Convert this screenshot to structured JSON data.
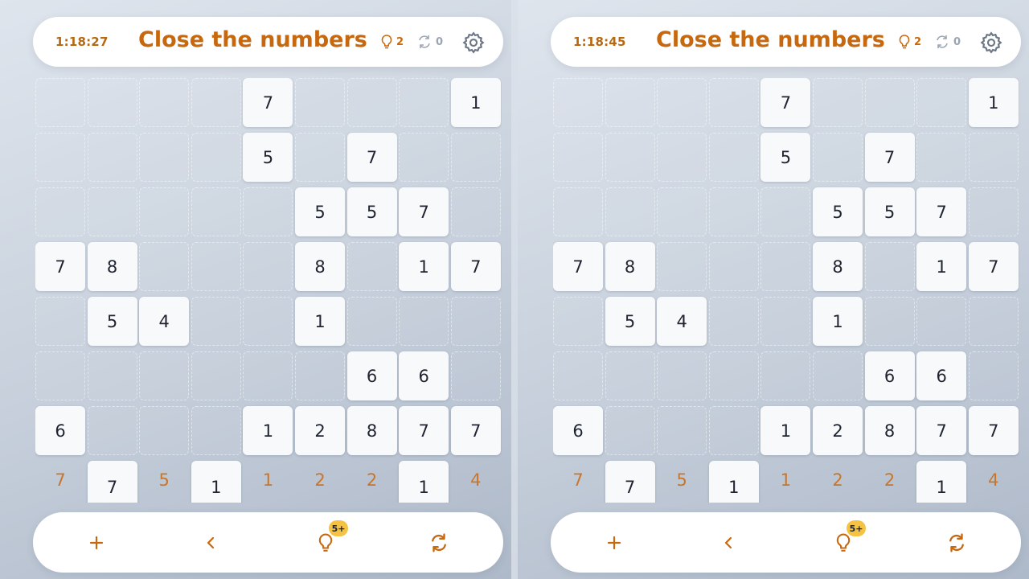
{
  "panels": [
    {
      "timer": "1:18:27",
      "title": "Close the numbers",
      "hint_count": "2",
      "shuffle_count": "0",
      "hint_badge": "5+"
    },
    {
      "timer": "1:18:45",
      "title": "Close the numbers",
      "hint_count": "2",
      "shuffle_count": "0",
      "hint_badge": "5+"
    }
  ],
  "board": {
    "rows": [
      [
        "",
        "",
        "",
        "",
        "7",
        "",
        "",
        "",
        "1"
      ],
      [
        "",
        "",
        "",
        "",
        "5",
        "",
        "7",
        "",
        ""
      ],
      [
        "",
        "",
        "",
        "",
        "",
        "5",
        "5",
        "7",
        ""
      ],
      [
        "7",
        "8",
        "",
        "",
        "",
        "8",
        "",
        "1",
        "7"
      ],
      [
        "",
        "5",
        "4",
        "",
        "",
        "1",
        "",
        "",
        ""
      ],
      [
        "",
        "",
        "",
        "",
        "",
        "",
        "6",
        "6",
        ""
      ],
      [
        "6",
        "",
        "",
        "",
        "1",
        "2",
        "8",
        "7",
        "7"
      ]
    ],
    "bottom_row": [
      {
        "value": "7",
        "state": "ghost"
      },
      {
        "value": "7",
        "state": "open"
      },
      {
        "value": "5",
        "state": "ghost"
      },
      {
        "value": "1",
        "state": "open"
      },
      {
        "value": "1",
        "state": "ghost"
      },
      {
        "value": "2",
        "state": "ghost"
      },
      {
        "value": "2",
        "state": "ghost"
      },
      {
        "value": "1",
        "state": "open"
      },
      {
        "value": "4",
        "state": "ghost"
      }
    ]
  },
  "icons": {
    "hint": "lightbulb-icon",
    "shuffle": "shuffle-icon",
    "settings": "gear-icon",
    "add": "plus-icon",
    "undo": "chevron-left-icon",
    "refresh": "refresh-icon"
  },
  "colors": {
    "accent": "#c8680e",
    "badge": "#f5c344",
    "muted": "#9aa5b4",
    "tile": "#f8f9fb"
  }
}
